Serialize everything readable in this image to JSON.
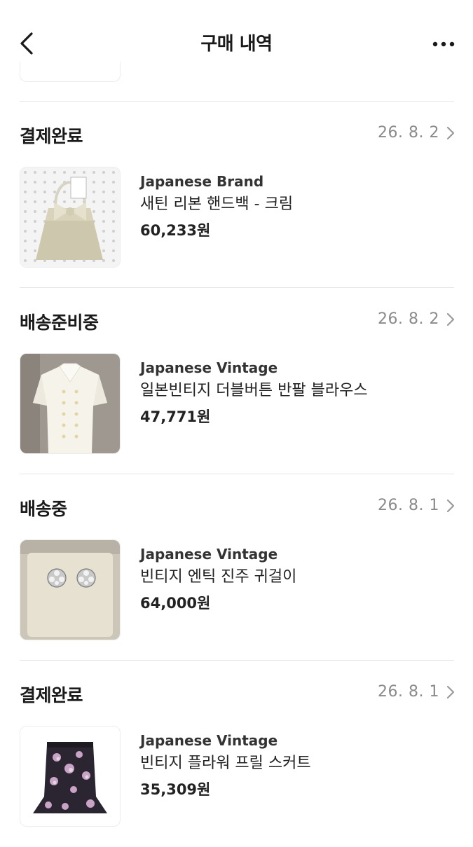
{
  "header": {
    "title": "구매 내역",
    "back_icon": "chevron-left-icon",
    "more_icon": "more-horizontal-icon"
  },
  "orders": [
    {
      "status": "결제완료",
      "date": "26. 8. 2",
      "brand": "Japanese Brand",
      "name": "새틴 리본 핸드백 - 크림",
      "price": "60,233원",
      "image": "cream-satin-ribbon-handbag"
    },
    {
      "status": "배송준비중",
      "date": "26. 8. 2",
      "brand": "Japanese Vintage",
      "name": "일본빈티지 더블버튼 반팔 블라우스",
      "price": "47,771원",
      "image": "white-double-button-blouse"
    },
    {
      "status": "배송중",
      "date": "26. 8. 1",
      "brand": "Japanese Vintage",
      "name": "빈티지 엔틱 진주 귀걸이",
      "price": "64,000원",
      "image": "silver-flower-earrings"
    },
    {
      "status": "결제완료",
      "date": "26. 8. 1",
      "brand": "Japanese Vintage",
      "name": "빈티지 플라워 프릴 스커트",
      "price": "35,309원",
      "image": "floral-frill-skirt"
    }
  ],
  "colors": {
    "text": "#222222",
    "date_gray": "#8a8a8a",
    "divider": "#e6e6e6"
  }
}
